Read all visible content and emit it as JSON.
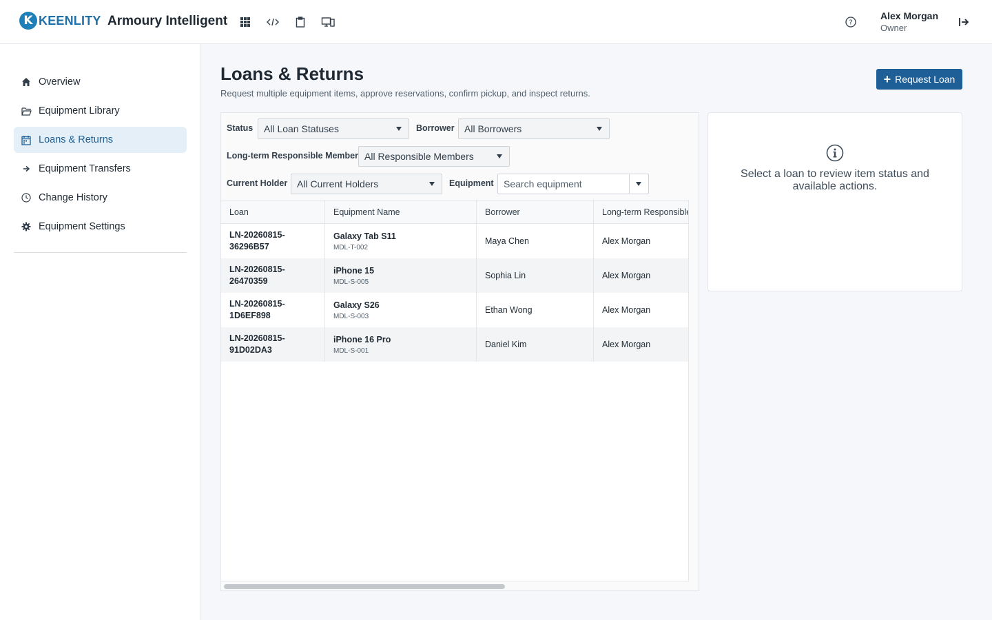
{
  "brand": {
    "logo_letter": "K",
    "logo_text": "KEENLITY",
    "app_title": "Armoury Intelligent"
  },
  "toolbar_icons": [
    "grid-icon",
    "code-icon",
    "clipboard-icon",
    "devices-icon"
  ],
  "user": {
    "name": "Alex Morgan",
    "role": "Owner"
  },
  "sidebar": {
    "items": [
      {
        "label": "Overview",
        "icon": "home-icon",
        "active": false
      },
      {
        "label": "Equipment Library",
        "icon": "folder-icon",
        "active": false
      },
      {
        "label": "Loans & Returns",
        "icon": "calendar-icon",
        "active": true
      },
      {
        "label": "Equipment Transfers",
        "icon": "arrow-right-icon",
        "active": false
      },
      {
        "label": "Change History",
        "icon": "clock-icon",
        "active": false
      },
      {
        "label": "Equipment Settings",
        "icon": "gear-icon",
        "active": false
      }
    ]
  },
  "page": {
    "title": "Loans & Returns",
    "subtitle": "Request multiple equipment items, approve reservations, confirm pickup, and inspect returns.",
    "request_button": "Request Loan"
  },
  "filters": {
    "status_label": "Status",
    "status_value": "All Loan Statuses",
    "borrower_label": "Borrower",
    "borrower_value": "All Borrowers",
    "responsible_label": "Long-term Responsible Member",
    "responsible_value": "All Responsible Members",
    "holder_label": "Current Holder",
    "holder_value": "All Current Holders",
    "equipment_label": "Equipment",
    "equipment_placeholder": "Search equipment"
  },
  "table": {
    "columns": [
      "Loan",
      "Equipment Name",
      "Borrower",
      "Long-term Responsible"
    ],
    "rows": [
      {
        "loan_line1": "LN-20260815-",
        "loan_line2": "36296B57",
        "equipment": "Galaxy Tab S11",
        "code": "MDL-T-002",
        "borrower": "Maya Chen",
        "responsible": "Alex Morgan"
      },
      {
        "loan_line1": "LN-20260815-",
        "loan_line2": "26470359",
        "equipment": "iPhone 15",
        "code": "MDL-S-005",
        "borrower": "Sophia Lin",
        "responsible": "Alex Morgan"
      },
      {
        "loan_line1": "LN-20260815-",
        "loan_line2": "1D6EF898",
        "equipment": "Galaxy S26",
        "code": "MDL-S-003",
        "borrower": "Ethan Wong",
        "responsible": "Alex Morgan"
      },
      {
        "loan_line1": "LN-20260815-",
        "loan_line2": "91D02DA3",
        "equipment": "iPhone 16 Pro",
        "code": "MDL-S-001",
        "borrower": "Daniel Kim",
        "responsible": "Alex Morgan"
      }
    ]
  },
  "detail": {
    "message": "Select a loan to review item status and available actions."
  },
  "colors": {
    "primary": "#1d5f96",
    "active_bg": "#e4eff8",
    "brand": "#1f7fb8"
  }
}
